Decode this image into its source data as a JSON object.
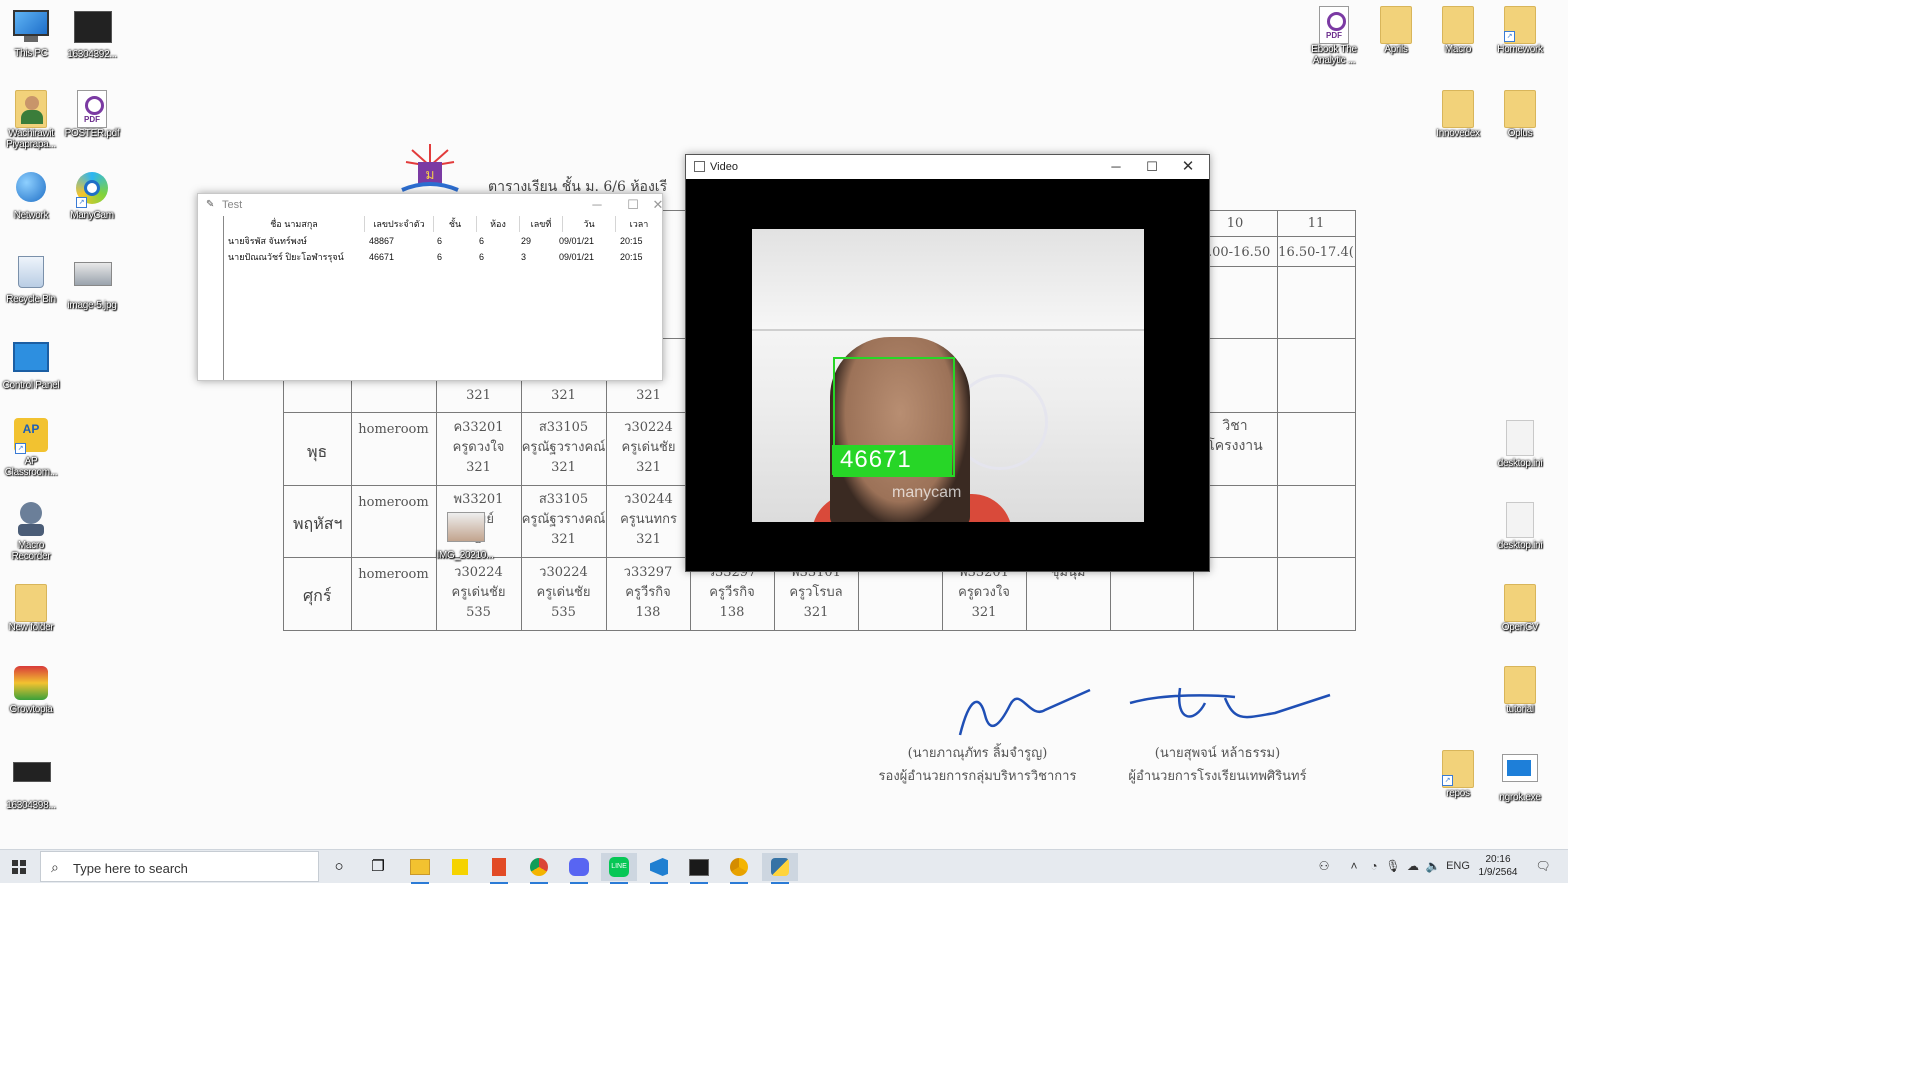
{
  "desktop": {
    "icons_left": [
      {
        "label": "This PC",
        "icon": "this-pc-icon"
      },
      {
        "label": "16304392...",
        "icon": "video-file-icon"
      },
      {
        "label": "Wachirawit Piyaprapa...",
        "icon": "user-folder-icon"
      },
      {
        "label": "POSTER.pdf",
        "icon": "pdf-icon"
      },
      {
        "label": "Network",
        "icon": "network-icon"
      },
      {
        "label": "ManyCam",
        "icon": "manycam-icon"
      },
      {
        "label": "Recycle Bin",
        "icon": "recycle-bin-icon"
      },
      {
        "label": "image-5.jpg",
        "icon": "image-file-icon"
      },
      {
        "label": "Control Panel",
        "icon": "control-panel-icon"
      },
      {
        "label": "AP Classroom...",
        "icon": "ap-classroom-icon"
      },
      {
        "label": "Macro Recorder",
        "icon": "macro-recorder-icon"
      },
      {
        "label": "New folder",
        "icon": "folder-icon"
      },
      {
        "label": "Growtopia",
        "icon": "growtopia-icon"
      },
      {
        "label": "16304398...",
        "icon": "video-file-icon"
      }
    ],
    "icons_right": [
      {
        "label": "Ebook The Analytic ...",
        "icon": "pdf-icon"
      },
      {
        "label": "Aprils",
        "icon": "folder-icon"
      },
      {
        "label": "Macro",
        "icon": "folder-icon"
      },
      {
        "label": "Homework",
        "icon": "folder-icon"
      },
      {
        "label": "Innovedex",
        "icon": "folder-icon"
      },
      {
        "label": "Oplus",
        "icon": "folder-icon"
      },
      {
        "label": "desktop.ini",
        "icon": "settings-file-icon"
      },
      {
        "label": "desktop.ini",
        "icon": "settings-file-icon"
      },
      {
        "label": "OpenCV",
        "icon": "folder-icon"
      },
      {
        "label": "tutorial",
        "icon": "folder-icon"
      },
      {
        "label": "repos",
        "icon": "folder-icon"
      },
      {
        "label": "ngrok.exe",
        "icon": "exe-icon"
      }
    ],
    "floating_icon": {
      "label": "IMG_20210..."
    }
  },
  "wallpaper": {
    "title": "ตารางเรียน ชั้น ม. 6/6 ห้องเรี",
    "col_headers": [
      "10",
      "11"
    ],
    "col_times": [
      "3.00-16.50",
      "16.50-17.4("
    ],
    "days": [
      "พุธ",
      "พฤหัสฯ",
      "ศุกร์"
    ],
    "homeroom": "homeroom",
    "row0": [
      "321",
      "321",
      "321"
    ],
    "row1": [
      "ค33201\nครูดวงใจ\n321",
      "ส33105\nครูณัฐวรางคณ์\n321",
      "ว30224\nครูเด่นชัย\n321"
    ],
    "row1_extra": "วิชา\nโครงงาน",
    "row2": [
      "พ33201\nกรมย์\n3",
      "ส33105\nครูณัฐวรางคณ์\n321",
      "ว30244\nครูนนทกร\n321"
    ],
    "row3": [
      "ว30224\nครูเด่นชัย\n535",
      "ว30224\nครูเด่นชัย\n535",
      "ว33297\nครูวีรกิจ\n138",
      "ว33297\nครูวีรกิจ\n138",
      "พ33101\nครูวโรบล\n321",
      "พ33201\nครูดวงใจ\n321",
      "ชุมนุม"
    ],
    "sig1_name": "(นายภาณุภัทร ลิ้มจำรูญ)",
    "sig1_title": "รองผู้อำนวยการกลุ่มบริหารวิชาการ",
    "sig2_name": "(นายสุพจน์ หล้าธรรม)",
    "sig2_title": "ผู้อำนวยการโรงเรียนเทพศิรินทร์"
  },
  "test_window": {
    "title": "Test",
    "columns": [
      "ชื่อ นามสกุล",
      "เลขประจำตัว",
      "ชั้น",
      "ห้อง",
      "เลขที่",
      "วัน",
      "เวลา"
    ],
    "rows": [
      [
        "นายจิรพัส จันทร์พงษ์",
        "48867",
        "6",
        "6",
        "29",
        "09/01/21",
        "20:15"
      ],
      [
        "นายปัณณวัชร์ ปิยะโอฬารรุจน์",
        "46671",
        "6",
        "6",
        "3",
        "09/01/21",
        "20:15"
      ]
    ]
  },
  "video_window": {
    "title": "Video",
    "face_label": "46671",
    "watermark": "manycam",
    "box_color": "#27d627"
  },
  "taskbar": {
    "search_placeholder": "Type here to search",
    "apps": [
      "cortana-icon",
      "task-view-icon",
      "file-explorer-icon",
      "sticky-notes-icon",
      "office-icon",
      "chrome-icon",
      "discord-icon",
      "line-icon",
      "vscode-icon",
      "terminal-icon",
      "chrome-canary-icon",
      "python-icon"
    ],
    "language": "ENG",
    "time": "20:16",
    "date": "1/9/2564"
  }
}
